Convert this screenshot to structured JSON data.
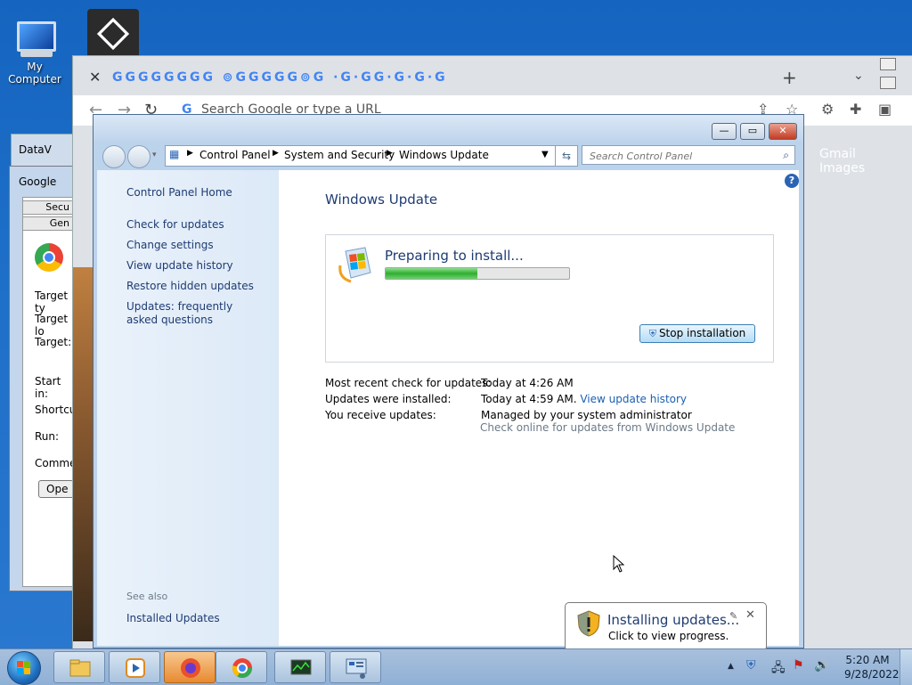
{
  "desktop": {
    "icons": [
      {
        "label": "My Computer"
      },
      {
        "label": ""
      }
    ]
  },
  "chrome": {
    "omnibox_placeholder": "Search Google or type a URL",
    "page_links": [
      "Gmail",
      "Images"
    ],
    "tab_favicons": "GGGGGGGG ⊚GGGGG⊚G ·G·GG·G·G·G"
  },
  "left_windows": {
    "datav_title": "DataV",
    "google_title": "Google",
    "tabs": [
      "Secu",
      "Gen"
    ],
    "labels": [
      "Target ty",
      "Target lo",
      "Target:",
      "Start in:",
      "Shortcut",
      "Run:",
      "Commen"
    ],
    "open_button": "Ope"
  },
  "wu_window": {
    "breadcrumbs": [
      "Control Panel",
      "System and Security",
      "Windows Update"
    ],
    "search_placeholder": "Search Control Panel",
    "left_nav": {
      "home": "Control Panel Home",
      "items": [
        "Check for updates",
        "Change settings",
        "View update history",
        "Restore hidden updates",
        "Updates: frequently asked questions"
      ],
      "see_also_heading": "See also",
      "see_also": [
        "Installed Updates"
      ]
    },
    "title": "Windows Update",
    "status": {
      "heading": "Preparing to install...",
      "progress_percent": 50,
      "stop_button": "Stop installation"
    },
    "info": [
      {
        "label": "Most recent check for updates:",
        "value": "Today at 4:26 AM",
        "link": ""
      },
      {
        "label": "Updates were installed:",
        "value": "Today at 4:59 AM.",
        "link": "View update history"
      },
      {
        "label": "You receive updates:",
        "value": "Managed by your system administrator",
        "link": ""
      }
    ],
    "check_online": "Check online for updates from Windows Update"
  },
  "balloon": {
    "title": "Installing updates...",
    "subtitle": "Click to view progress."
  },
  "taskbar": {
    "time": "5:20 AM",
    "date": "9/28/2022"
  },
  "colors": {
    "link": "#1a5fb4",
    "heading": "#1e3b72",
    "progress": "#2fae2f"
  }
}
